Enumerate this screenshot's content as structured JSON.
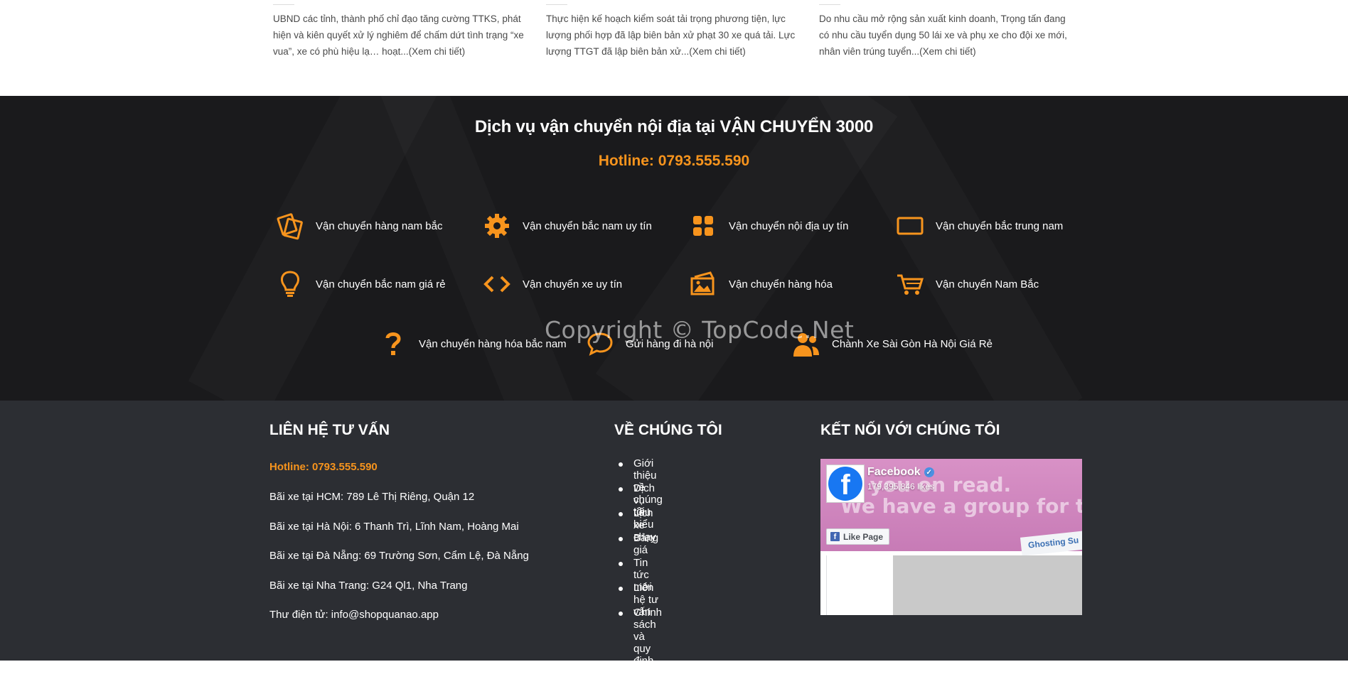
{
  "news": [
    {
      "excerpt": "UBND các tỉnh, thành phố chỉ đạo tăng cường TTKS, phát hiện và kiên quyết xử lý nghiêm để chấm dứt tình trạng “xe vua”, xe có phù hiệu lạ… hoạt...",
      "more": "(Xem chi tiết)"
    },
    {
      "excerpt": "Thực hiện kế hoạch kiểm soát tải trọng phương tiện, lực lượng phối hợp đã lập biên bản xử phạt 30 xe quá tải. Lực lượng TTGT đã lập biên bản xử...",
      "more": "(Xem chi tiết)"
    },
    {
      "excerpt": "Do nhu cầu mở rộng sản xuất kinh doanh, Trọng tấn đang có nhu cầu tuyển dụng 50 lái xe và phụ xe cho đội xe mới, nhân viên trúng tuyển...",
      "more": "(Xem chi tiết)"
    }
  ],
  "services": {
    "title": "Dịch vụ vận chuyển nội địa tại VẬN CHUYỂN 3000",
    "hotline": "Hotline: 0793.555.590",
    "accent": "#f7941d",
    "items": [
      {
        "label": "Vận chuyển hàng nam bắc",
        "icon": "cards-icon"
      },
      {
        "label": "Vận chuyển bắc nam uy tín",
        "icon": "gear-icon"
      },
      {
        "label": "Vận chuyển nội địa uy tín",
        "icon": "grid-icon"
      },
      {
        "label": "Vận chuyển bắc trung nam",
        "icon": "rectangle-icon"
      },
      {
        "label": "Vận chuyển bắc nam giá rẻ",
        "icon": "lightbulb-icon"
      },
      {
        "label": "Vận chuyển xe uy tín",
        "icon": "code-icon"
      },
      {
        "label": "Vận chuyển hàng hóa",
        "icon": "picture-icon"
      },
      {
        "label": "Vận chuyển Nam Bắc",
        "icon": "cart-icon"
      },
      {
        "label": "Vận chuyển hàng hóa bắc nam",
        "icon": "question-icon"
      },
      {
        "label": "Gửi hàng đi hà nội",
        "icon": "chat-icon"
      },
      {
        "label": "Chành Xe Sài Gòn Hà Nội Giá Rẻ",
        "icon": "users-icon"
      }
    ]
  },
  "watermark": "Copyright © TopCode.Net",
  "footer": {
    "contact": {
      "heading": "LIÊN HỆ TƯ VẤN",
      "hotline": "Hotline: 0793.555.590",
      "lines": [
        "Bãi xe tại HCM: 789 Lê Thị Riêng, Quận 12",
        "Bãi xe tại Hà Nội: 6 Thanh Trì, Lĩnh Nam, Hoàng Mai",
        "Bãi xe tại Đà Nẵng: 69 Trường Sơn, Cẩm Lệ, Đà Nẵng",
        "Bãi xe tại Nha Trang: G24 Ql1, Nha Trang",
        "Thư điện tử: info@shopquanao.app"
      ]
    },
    "about": {
      "heading": "VỀ CHÚNG TÔI",
      "links": [
        "Giới thiệu về chúng tôi",
        "Dịch vụ tiêu biểu",
        "Lịch xe chạy",
        "Bảng giá",
        "Tin tức mới",
        "Liên hệ tư vấn",
        "Chính sách và quy định chung"
      ]
    },
    "connect": {
      "heading": "KẾT NỐI VỚI CHÚNG TÔI",
      "facebook": {
        "name": "Facebook",
        "likes": "179,395,846 likes",
        "like_button": "Like Page",
        "cover_line1": "... you on read.",
        "cover_line2": "We have a group for the",
        "cover_tag": "Ghosting Su"
      }
    }
  }
}
